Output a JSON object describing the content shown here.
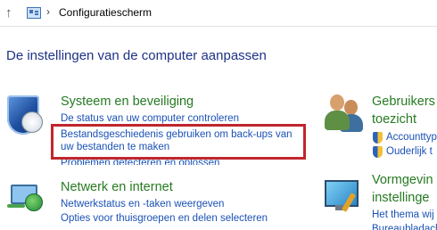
{
  "addressbar": {
    "up_glyph": "↑",
    "separator": "›",
    "breadcrumb": "Configuratiescherm"
  },
  "page_title": "De instellingen van de computer aanpassen",
  "categories": [
    {
      "title": "Systeem en beveiliging",
      "icon": "security-shield-icon",
      "links": [
        "De status van uw computer controleren",
        "Bestandsgeschiedenis gebruiken om back-ups van",
        "uw bestanden te maken",
        "Problemen detecteren en oplossen"
      ]
    },
    {
      "title": "Netwerk en internet",
      "icon": "network-globe-icon",
      "links": [
        "Netwerkstatus en -taken weergeven",
        "Opties voor thuisgroepen en delen selecteren"
      ]
    },
    {
      "title_line1": "Gebruikers",
      "title_line2": "toezicht",
      "icon": "users-icon",
      "links": [
        "Accounttyp",
        "Ouderlijk t"
      ]
    },
    {
      "title_line1": "Vormgevin",
      "title_line2": "instellinge",
      "icon": "appearance-display-icon",
      "links": [
        "Het thema wij",
        "Bureaubladach"
      ]
    }
  ],
  "colors": {
    "category_title": "#267a22",
    "link": "#1a51b6",
    "page_title": "#1e3287",
    "highlight": "#c0262d"
  }
}
